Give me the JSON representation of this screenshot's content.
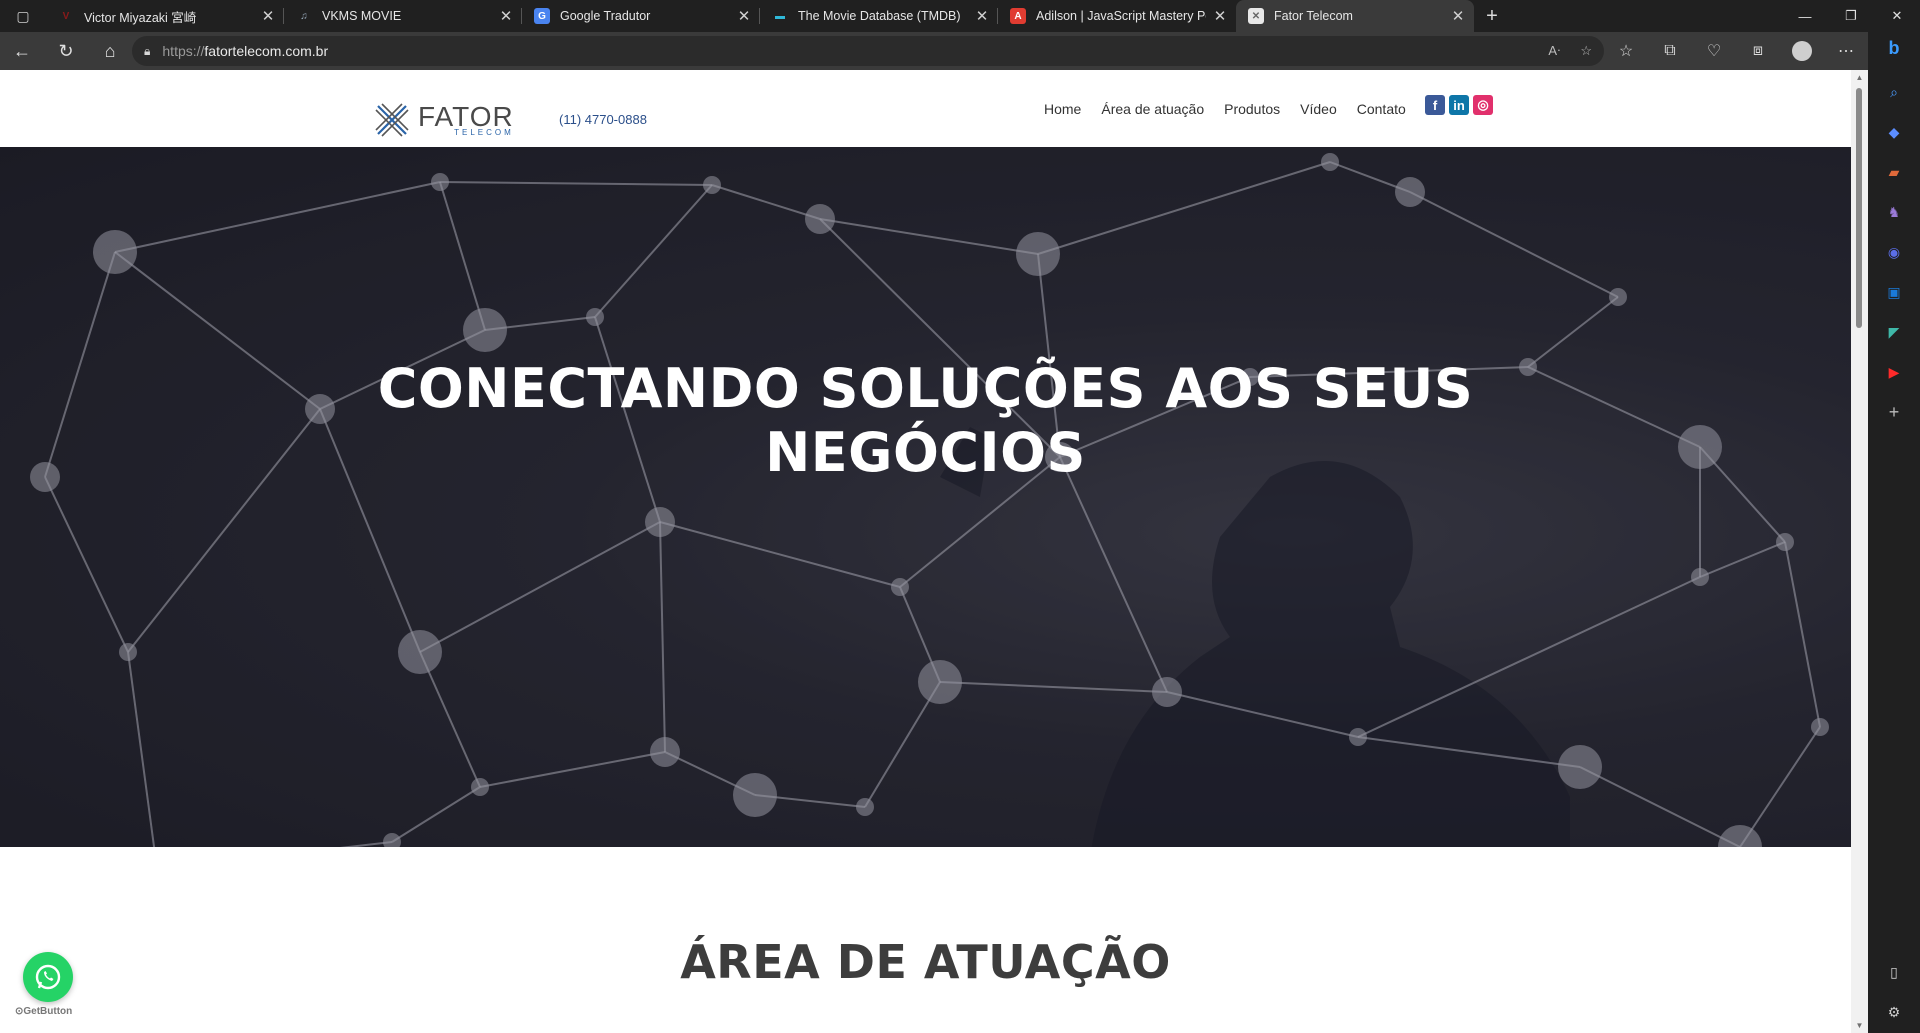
{
  "browser": {
    "tabs": [
      {
        "title": "Victor Miyazaki 宮崎",
        "favicon": "V",
        "fav_color": "#8b1a1a",
        "fav_bg": "#202020"
      },
      {
        "title": "VKMS MOVIE",
        "favicon": "♫",
        "fav_color": "#9ab",
        "fav_bg": "#202020"
      },
      {
        "title": "Google Tradutor",
        "favicon": "G",
        "fav_color": "#ffffff",
        "fav_bg": "#4a84f0"
      },
      {
        "title": "The Movie Database (TMDB)",
        "favicon": "▬",
        "fav_color": "#2fb8d8",
        "fav_bg": "#202020"
      },
      {
        "title": "Adilson | JavaScript Mastery Portf",
        "favicon": "A",
        "fav_color": "#ffffff",
        "fav_bg": "#e03c31"
      },
      {
        "title": "Fator Telecom",
        "favicon": "✕",
        "fav_color": "#666",
        "fav_bg": "#e8e8e8"
      }
    ],
    "url_proto": "https://",
    "url_host": "fatortelecom.com.br"
  },
  "site": {
    "logo_text": "FATOR",
    "logo_sub": "TELECOM",
    "phone": "(11) 4770-0888",
    "menu": [
      "Home",
      "Área de atuação",
      "Produtos",
      "Vídeo",
      "Contato"
    ],
    "social": [
      {
        "name": "facebook",
        "glyph": "f",
        "color": "#3b5998"
      },
      {
        "name": "linkedin",
        "glyph": "in",
        "color": "#0e76a8"
      },
      {
        "name": "instagram",
        "glyph": "◎",
        "color": "#e1306c"
      }
    ],
    "hero_line1": "CONECTANDO SOLUÇÕES AOS SEUS",
    "hero_line2": "NEGÓCIOS",
    "section_title": "ÁREA DE ATUAÇÃO",
    "getbutton_label": "GetButton"
  }
}
